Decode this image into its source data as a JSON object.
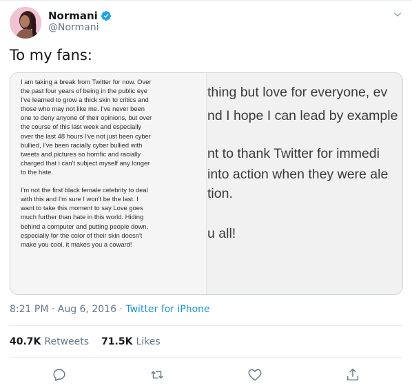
{
  "user": {
    "display_name": "Normani",
    "handle": "@Normani"
  },
  "tweet": {
    "text": "To my fans:",
    "timestamp": "8:21 PM · Aug 6, 2016",
    "separator": " · ",
    "source": "Twitter for iPhone"
  },
  "media": {
    "left_text": "I am taking a break from Twitter for now.  Over\nthe past four years of being in the public eye\nI've learned to grow a thick skin to critics and\nthose who may not like me. I've never been\none to deny anyone of their opinions, but over\nthe course of this last week and especially\nover the last 48 hours I've not just been cyber\nbullied, I've been racially cyber bullied with\ntweets and pictures so horrific and racially\ncharged that i can't subject myself any longer\nto the hate.\n\nI'm not the first black female celebrity to deal\nwith this and I'm sure  I won't be the last.  I\nwant to take this moment to say Love goes\nmuch further than hate in this world.  Hiding\nbehind a computer and putting people down,\nespecially for the color of their skin doesn't\nmake you cool, it makes you a coward!",
    "right_lines": [
      "thing but love for everyone, ev",
      "nd I hope I can lead by example",
      "nt to thank Twitter for immedi",
      "into action when they were ale",
      "tion.",
      "u all!"
    ]
  },
  "stats": {
    "retweets_count": "40.7K",
    "retweets_label": "Retweets",
    "likes_count": "71.5K",
    "likes_label": "Likes"
  },
  "colors": {
    "accent": "#1b95e0",
    "verified": "#1da1f2",
    "muted": "#657786",
    "text": "#14171a",
    "border": "#e6ecf0"
  },
  "icons": {
    "verified": "verified-badge-icon",
    "chevron": "chevron-down-icon",
    "reply": "reply-icon",
    "retweet": "retweet-icon",
    "like": "heart-icon",
    "share": "share-icon"
  }
}
